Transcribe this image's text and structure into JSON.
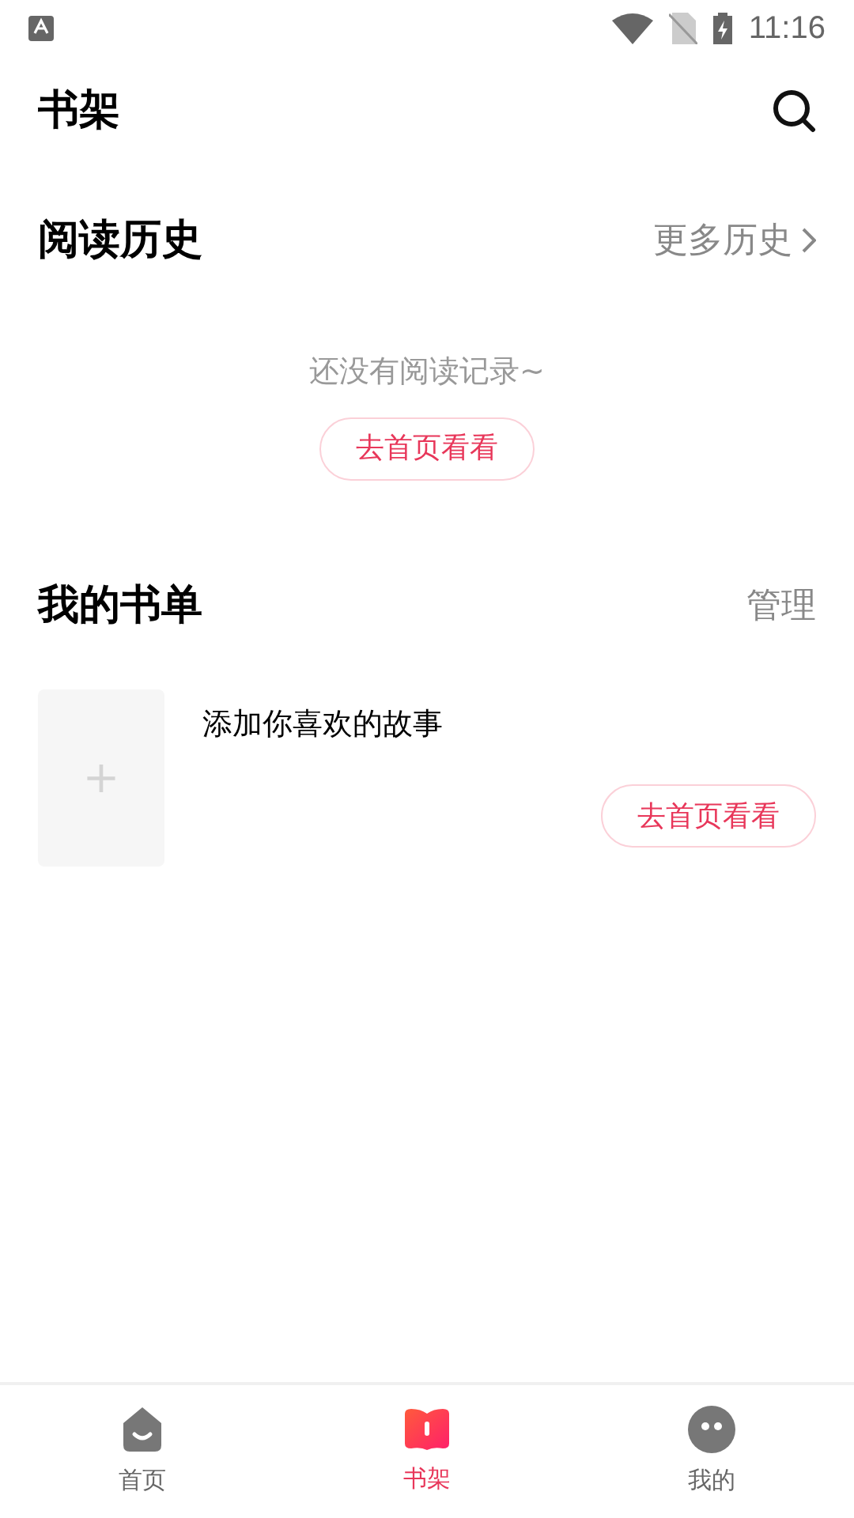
{
  "status_bar": {
    "time": "11:16"
  },
  "header": {
    "title": "书架"
  },
  "history": {
    "title": "阅读历史",
    "more": "更多历史",
    "empty_text": "还没有阅读记录~",
    "button": "去首页看看"
  },
  "booklist": {
    "title": "我的书单",
    "manage": "管理",
    "add_mark": "+",
    "add_text": "添加你喜欢的故事",
    "button": "去首页看看"
  },
  "tabs": [
    {
      "label": "首页",
      "kind": "home",
      "selected": false
    },
    {
      "label": "书架",
      "kind": "shelf",
      "selected": true
    },
    {
      "label": "我的",
      "kind": "me",
      "selected": false
    }
  ]
}
